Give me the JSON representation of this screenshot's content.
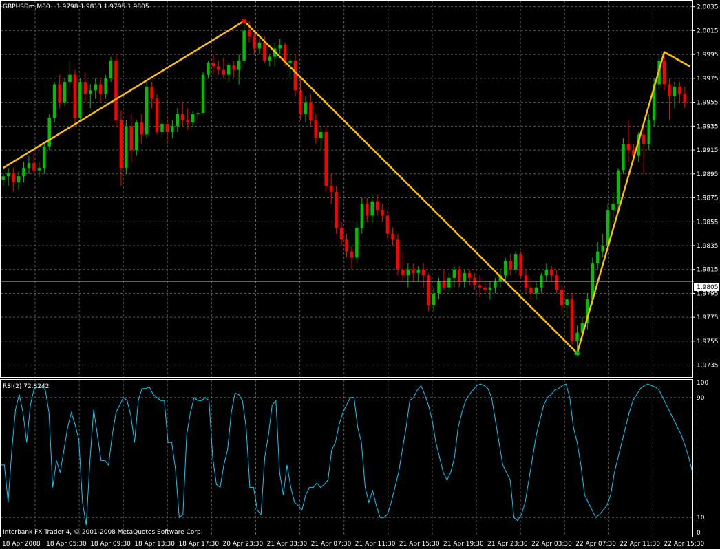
{
  "header": {
    "symbol_timeframe": "GBPUSDm,M30",
    "ohlc_text": "1.9798 1.9813 1.9795 1.9805"
  },
  "rsi_header": {
    "label": "RSI(2) 72.8242"
  },
  "current_price_label": "1.9805",
  "footer": {
    "copyright": "Interbank FX Trader 4, © 2001-2008 MetaQuotes Software Corp."
  },
  "colors": {
    "background": "#000000",
    "grid": "#5a5a5a",
    "axis_text": "#ffffff",
    "bull_candle": "#00c000",
    "bear_candle": "#ff0000",
    "zigzag": "#ffc000",
    "rsi_line": "#00d0ff"
  },
  "chart_data": [
    {
      "type": "candlestick",
      "title": "GBPUSDm,M30",
      "grid": true,
      "ylim": [
        1.9725,
        2.004
      ],
      "y_ticks": [
        "2.0035",
        "2.0015",
        "1.9995",
        "1.9975",
        "1.9955",
        "1.9935",
        "1.9915",
        "1.9895",
        "1.9875",
        "1.9855",
        "1.9835",
        "1.9815",
        "1.9795",
        "1.9775",
        "1.9755",
        "1.9735"
      ],
      "x_ticks": [
        "18 Apr 2008",
        "18 Apr 05:30",
        "18 Apr 09:30",
        "18 Apr 13:30",
        "18 Apr 17:30",
        "20 Apr 23:30",
        "21 Apr 03:30",
        "21 Apr 07:30",
        "21 Apr 11:30",
        "21 Apr 15:30",
        "21 Apr 19:30",
        "21 Apr 23:30",
        "22 Apr 03:30",
        "22 Apr 07:30",
        "22 Apr 11:30",
        "22 Apr 15:30"
      ],
      "last_price": 1.9805,
      "candles": [
        [
          1.989,
          1.9895,
          1.9885,
          1.9893
        ],
        [
          1.9893,
          1.99,
          1.9885,
          1.9896
        ],
        [
          1.9896,
          1.99,
          1.988,
          1.9888
        ],
        [
          1.9888,
          1.9897,
          1.9882,
          1.9893
        ],
        [
          1.9893,
          1.9905,
          1.9888,
          1.99
        ],
        [
          1.99,
          1.991,
          1.9895,
          1.9904
        ],
        [
          1.9904,
          1.9912,
          1.9895,
          1.9898
        ],
        [
          1.9898,
          1.9905,
          1.9892,
          1.99
        ],
        [
          1.99,
          1.992,
          1.9895,
          1.9918
        ],
        [
          1.9918,
          1.9945,
          1.9915,
          1.9942
        ],
        [
          1.9942,
          1.9972,
          1.9938,
          1.997
        ],
        [
          1.997,
          1.9978,
          1.995,
          1.9955
        ],
        [
          1.9955,
          1.9975,
          1.9952,
          1.9972
        ],
        [
          1.9972,
          1.999,
          1.996,
          1.9978
        ],
        [
          1.9978,
          1.9982,
          1.9935,
          1.9942
        ],
        [
          1.9942,
          1.9975,
          1.994,
          1.9972
        ],
        [
          1.9972,
          1.998,
          1.9955,
          1.9962
        ],
        [
          1.9962,
          1.997,
          1.995,
          1.9965
        ],
        [
          1.9965,
          1.9975,
          1.9958,
          1.997
        ],
        [
          1.997,
          1.9975,
          1.9955,
          1.9962
        ],
        [
          1.9962,
          1.9978,
          1.9958,
          1.9975
        ],
        [
          1.9975,
          1.9993,
          1.9972,
          1.999
        ],
        [
          1.999,
          1.9995,
          1.9935,
          1.994
        ],
        [
          1.994,
          1.9948,
          1.9885,
          1.99
        ],
        [
          1.99,
          1.994,
          1.9895,
          1.9935
        ],
        [
          1.9935,
          1.9945,
          1.9905,
          1.9915
        ],
        [
          1.9915,
          1.994,
          1.991,
          1.9938
        ],
        [
          1.9938,
          1.9945,
          1.992,
          1.9928
        ],
        [
          1.9928,
          1.9972,
          1.9925,
          1.9968
        ],
        [
          1.9968,
          1.9972,
          1.995,
          1.9958
        ],
        [
          1.9958,
          1.9962,
          1.9928,
          1.993
        ],
        [
          1.993,
          1.994,
          1.9925,
          1.9937
        ],
        [
          1.9937,
          1.9942,
          1.992,
          1.993
        ],
        [
          1.993,
          1.994,
          1.9925,
          1.9935
        ],
        [
          1.9935,
          1.995,
          1.993,
          1.9945
        ],
        [
          1.9945,
          1.9955,
          1.9935,
          1.994
        ],
        [
          1.994,
          1.995,
          1.9932,
          1.9938
        ],
        [
          1.9938,
          1.9948,
          1.9935,
          1.9945
        ],
        [
          1.9945,
          1.9948,
          1.994,
          1.9946
        ],
        [
          1.9946,
          1.998,
          1.9975,
          1.9978
        ],
        [
          1.9978,
          1.999,
          1.9975,
          1.9988
        ],
        [
          1.9988,
          1.9995,
          1.9978,
          1.9985
        ],
        [
          1.9985,
          1.999,
          1.9978,
          1.9982
        ],
        [
          1.9982,
          1.9992,
          1.9975,
          1.9978
        ],
        [
          1.9978,
          1.9988,
          1.9972,
          1.9986
        ],
        [
          1.9986,
          1.999,
          1.9975,
          1.9982
        ],
        [
          1.9982,
          1.9995,
          1.997,
          1.999
        ],
        [
          1.999,
          2.002,
          1.9988,
          2.0015
        ],
        [
          2.0015,
          2.0023,
          2.0005,
          2.001
        ],
        [
          2.001,
          2.0015,
          1.9995,
          2.0
        ],
        [
          2.0,
          2.0008,
          1.9995,
          2.0005
        ],
        [
          2.0005,
          2.001,
          1.9988,
          1.999
        ],
        [
          1.999,
          1.9995,
          1.9985,
          1.9993
        ],
        [
          1.9993,
          2.0005,
          1.9985,
          2.0
        ],
        [
          2.0,
          2.0008,
          1.9995,
          2.0003
        ],
        [
          2.0003,
          2.0005,
          1.9985,
          1.9988
        ],
        [
          1.9988,
          1.9995,
          1.9975,
          1.999
        ],
        [
          1.999,
          1.9995,
          1.996,
          1.9965
        ],
        [
          1.9965,
          1.9975,
          1.994,
          1.9945
        ],
        [
          1.9945,
          1.996,
          1.9938,
          1.9955
        ],
        [
          1.9955,
          1.9962,
          1.9935,
          1.994
        ],
        [
          1.994,
          1.9945,
          1.992,
          1.9925
        ],
        [
          1.9925,
          1.9935,
          1.9915,
          1.993
        ],
        [
          1.993,
          1.9935,
          1.988,
          1.9885
        ],
        [
          1.9885,
          1.9895,
          1.987,
          1.988
        ],
        [
          1.988,
          1.9885,
          1.9845,
          1.985
        ],
        [
          1.985,
          1.9855,
          1.9835,
          1.984
        ],
        [
          1.984,
          1.9845,
          1.9825,
          1.983
        ],
        [
          1.983,
          1.9835,
          1.9815,
          1.9825
        ],
        [
          1.9825,
          1.9855,
          1.982,
          1.985
        ],
        [
          1.985,
          1.9875,
          1.9845,
          1.987
        ],
        [
          1.987,
          1.9875,
          1.9855,
          1.986
        ],
        [
          1.986,
          1.9878,
          1.9855,
          1.9872
        ],
        [
          1.9872,
          1.9878,
          1.986,
          1.9865
        ],
        [
          1.9865,
          1.987,
          1.9855,
          1.986
        ],
        [
          1.986,
          1.9865,
          1.984,
          1.9845
        ],
        [
          1.9845,
          1.985,
          1.9835,
          1.984
        ],
        [
          1.984,
          1.9845,
          1.981,
          1.9815
        ],
        [
          1.9815,
          1.983,
          1.9805,
          1.981
        ],
        [
          1.981,
          1.982,
          1.98,
          1.9815
        ],
        [
          1.9815,
          1.982,
          1.9805,
          1.9812
        ],
        [
          1.9812,
          1.9818,
          1.9805,
          1.9815
        ],
        [
          1.9815,
          1.982,
          1.98,
          1.981
        ],
        [
          1.981,
          1.9812,
          1.978,
          1.9785
        ],
        [
          1.9785,
          1.98,
          1.978,
          1.9795
        ],
        [
          1.9795,
          1.9808,
          1.979,
          1.9805
        ],
        [
          1.9805,
          1.9815,
          1.9798,
          1.98
        ],
        [
          1.98,
          1.9812,
          1.9795,
          1.9808
        ],
        [
          1.9808,
          1.9818,
          1.98,
          1.9815
        ],
        [
          1.9815,
          1.9818,
          1.98,
          1.9805
        ],
        [
          1.9805,
          1.9815,
          1.98,
          1.9812
        ],
        [
          1.9812,
          1.9815,
          1.9802,
          1.9808
        ],
        [
          1.9808,
          1.9812,
          1.9798,
          1.9802
        ],
        [
          1.9802,
          1.981,
          1.9792,
          1.98
        ],
        [
          1.98,
          1.9805,
          1.9795,
          1.9798
        ],
        [
          1.9798,
          1.9805,
          1.979,
          1.98
        ],
        [
          1.98,
          1.9808,
          1.9795,
          1.9805
        ],
        [
          1.9805,
          1.9815,
          1.98,
          1.981
        ],
        [
          1.981,
          1.9825,
          1.9805,
          1.9822
        ],
        [
          1.9822,
          1.9828,
          1.981,
          1.9815
        ],
        [
          1.9815,
          1.983,
          1.9812,
          1.9828
        ],
        [
          1.9828,
          1.983,
          1.9808,
          1.981
        ],
        [
          1.981,
          1.9815,
          1.9795,
          1.98
        ],
        [
          1.98,
          1.9808,
          1.979,
          1.9795
        ],
        [
          1.9795,
          1.9805,
          1.979,
          1.98
        ],
        [
          1.98,
          1.9812,
          1.9795,
          1.981
        ],
        [
          1.981,
          1.982,
          1.9805,
          1.9815
        ],
        [
          1.9815,
          1.9818,
          1.9805,
          1.981
        ],
        [
          1.981,
          1.9815,
          1.9795,
          1.9798
        ],
        [
          1.9798,
          1.9802,
          1.978,
          1.9785
        ],
        [
          1.9785,
          1.9795,
          1.9775,
          1.979
        ],
        [
          1.979,
          1.9795,
          1.9752,
          1.9755
        ],
        [
          1.9755,
          1.9768,
          1.9745,
          1.9762
        ],
        [
          1.9762,
          1.9775,
          1.9755,
          1.977
        ],
        [
          1.977,
          1.9795,
          1.9765,
          1.979
        ],
        [
          1.979,
          1.9825,
          1.9785,
          1.982
        ],
        [
          1.982,
          1.9838,
          1.9815,
          1.983
        ],
        [
          1.983,
          1.9845,
          1.9825,
          1.9835
        ],
        [
          1.9835,
          1.987,
          1.983,
          1.9865
        ],
        [
          1.9865,
          1.988,
          1.9855,
          1.987
        ],
        [
          1.987,
          1.99,
          1.9865,
          1.9898
        ],
        [
          1.9898,
          1.9925,
          1.9895,
          1.992
        ],
        [
          1.992,
          1.994,
          1.9905,
          1.9915
        ],
        [
          1.9915,
          1.992,
          1.9905,
          1.991
        ],
        [
          1.991,
          1.993,
          1.9905,
          1.9928
        ],
        [
          1.9928,
          1.9935,
          1.9895,
          1.992
        ],
        [
          1.992,
          1.9945,
          1.9915,
          1.994
        ],
        [
          1.994,
          1.9975,
          1.9935,
          1.997
        ],
        [
          1.997,
          1.9995,
          1.9965,
          1.999
        ],
        [
          1.999,
          1.9995,
          1.9965,
          1.997
        ],
        [
          1.997,
          1.9975,
          1.994,
          1.996
        ],
        [
          1.996,
          1.9972,
          1.995,
          1.9968
        ],
        [
          1.9968,
          1.9972,
          1.9955,
          1.9962
        ],
        [
          1.9962,
          1.9968,
          1.995,
          1.9955
        ]
      ],
      "zigzag": [
        {
          "index": 0,
          "price": 1.99
        },
        {
          "index": 47,
          "price": 2.0023
        },
        {
          "index": 112,
          "price": 1.9745
        },
        {
          "index": 129,
          "price": 1.9997
        },
        {
          "index": 134,
          "price": 1.9985
        }
      ]
    },
    {
      "type": "line",
      "title": "RSI(2) 72.8242",
      "ylim": [
        0,
        100
      ],
      "y_ticks": [
        "100",
        "90",
        "10",
        "0"
      ],
      "series": [
        {
          "values": [
            45,
            45,
            20,
            55,
            82,
            92,
            80,
            60,
            85,
            96,
            97,
            97,
            95,
            80,
            30,
            48,
            40,
            55,
            70,
            80,
            72,
            62,
            20,
            5,
            48,
            82,
            65,
            48,
            48,
            45,
            65,
            80,
            85,
            90,
            88,
            78,
            60,
            88,
            96,
            96,
            97,
            92,
            90,
            88,
            88,
            60,
            60,
            42,
            10,
            12,
            65,
            80,
            90,
            88,
            88,
            90,
            88,
            50,
            32,
            30,
            45,
            55,
            80,
            93,
            92,
            88,
            70,
            30,
            30,
            15,
            12,
            50,
            65,
            85,
            88,
            40,
            25,
            45,
            30,
            20,
            18,
            15,
            25,
            30,
            30,
            33,
            30,
            32,
            35,
            55,
            60,
            72,
            80,
            85,
            90,
            90,
            70,
            60,
            30,
            20,
            28,
            18,
            10,
            10,
            12,
            20,
            30,
            40,
            55,
            70,
            88,
            90,
            95,
            98,
            92,
            85,
            75,
            60,
            50,
            40,
            35,
            40,
            50,
            70,
            80,
            88,
            92,
            95,
            98,
            99,
            98,
            96,
            90,
            75,
            60,
            45,
            40,
            35,
            10,
            8,
            12,
            20,
            35,
            50,
            65,
            75,
            85,
            90,
            92,
            95,
            96,
            98,
            99,
            90,
            70,
            60,
            45,
            25,
            20,
            15,
            10,
            12,
            15,
            18,
            25,
            40,
            50,
            60,
            70,
            80,
            88,
            92,
            96,
            98,
            99,
            98,
            97,
            95,
            90,
            85,
            80,
            75,
            70,
            65,
            58,
            50,
            40
          ]
        }
      ]
    }
  ]
}
